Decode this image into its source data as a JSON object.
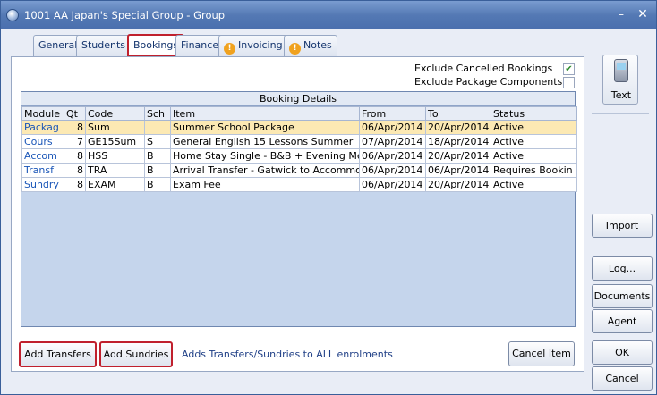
{
  "window": {
    "title": "1001 AA Japan's Special Group - Group",
    "minimize_glyph": "–",
    "close_glyph": "✕"
  },
  "tabs": [
    {
      "label": "General"
    },
    {
      "label": "Students"
    },
    {
      "label": "Bookings"
    },
    {
      "label": "Finance"
    },
    {
      "label": "Invoicing",
      "icon": "warning-icon"
    },
    {
      "label": "Notes",
      "icon": "warning-icon"
    }
  ],
  "warning_glyph": "!",
  "options": {
    "exclude_cancelled_label": "Exclude Cancelled Bookings",
    "exclude_cancelled_checked": true,
    "check_glyph": "✔",
    "exclude_package_label": "Exclude Package Components",
    "exclude_package_checked": false
  },
  "grid": {
    "title": "Booking Details",
    "columns": [
      "Module",
      "Qt",
      "Code",
      "Sch",
      "Item",
      "From",
      "To",
      "Status"
    ],
    "rows": [
      [
        "Packag",
        "8",
        "Sum",
        "",
        "Summer School Package",
        "06/Apr/2014",
        "20/Apr/2014",
        "Active"
      ],
      [
        "Cours",
        "7",
        "GE15Sum",
        "S",
        "General English 15 Lessons Summer",
        "07/Apr/2014",
        "18/Apr/2014",
        "Active"
      ],
      [
        "Accom",
        "8",
        "HSS",
        "B",
        "Home Stay Single - B&B + Evening Meal",
        "06/Apr/2014",
        "20/Apr/2014",
        "Active"
      ],
      [
        "Transf",
        "8",
        "TRA",
        "B",
        "Arrival Transfer - Gatwick to Accommoda",
        "06/Apr/2014",
        "06/Apr/2014",
        "Requires Bookin"
      ],
      [
        "Sundry",
        "8",
        "EXAM",
        "B",
        "Exam Fee",
        "06/Apr/2014",
        "20/Apr/2014",
        "Active"
      ]
    ]
  },
  "bottom": {
    "add_transfers": "Add Transfers",
    "add_sundries": "Add Sundries",
    "note": "Adds Transfers/Sundries to ALL enrolments",
    "cancel_item": "Cancel Item"
  },
  "side": {
    "text": "Text",
    "text_icon": "phone-icon",
    "import": "Import",
    "log": "Log...",
    "documents": "Documents",
    "agent": "Agent",
    "ok": "OK",
    "cancel": "Cancel"
  },
  "colors": {
    "highlight_border": "#c0202d",
    "selected_row": "#fce9b3",
    "module_link": "#1a56b8"
  }
}
